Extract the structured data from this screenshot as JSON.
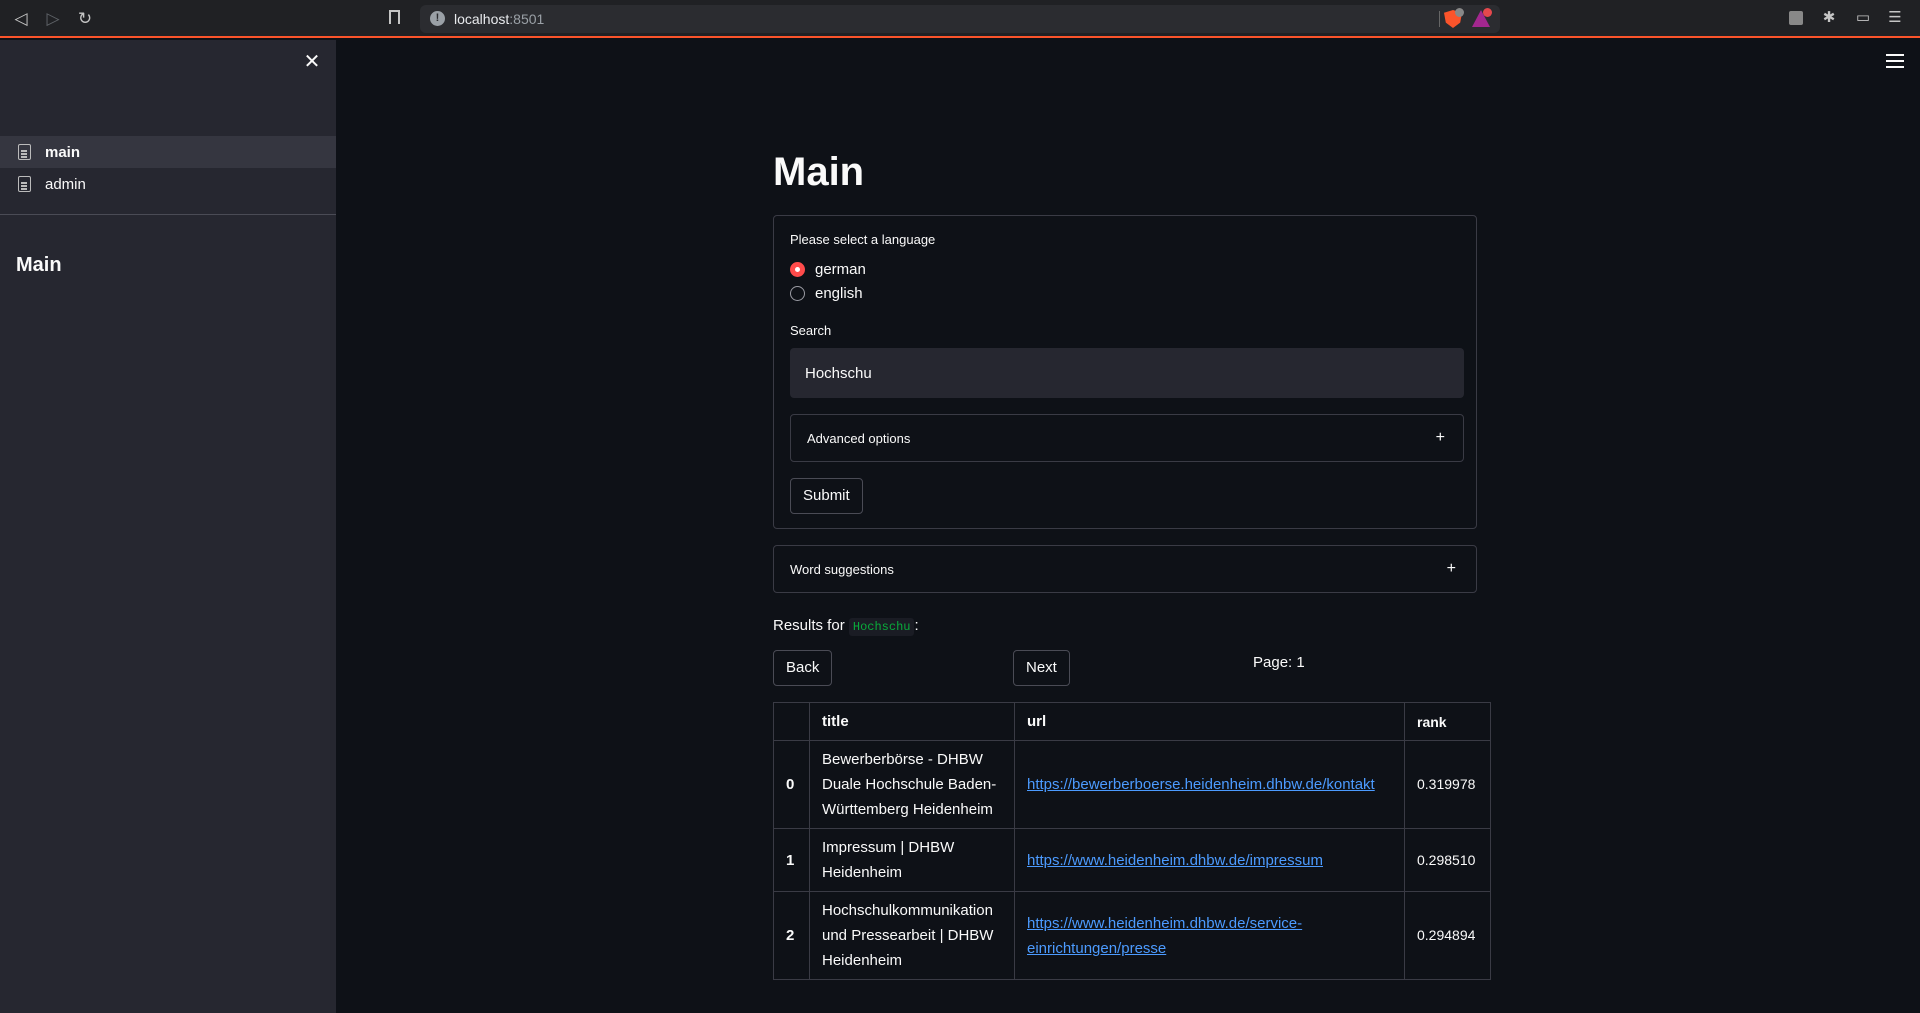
{
  "browser": {
    "url_host": "localhost",
    "url_port": ":8501"
  },
  "sidebar": {
    "items": [
      {
        "label": "main"
      },
      {
        "label": "admin"
      }
    ],
    "title": "Main"
  },
  "main": {
    "title": "Main",
    "language_label": "Please select a language",
    "languages": [
      "german",
      "english"
    ],
    "selected_language": "german",
    "search_label": "Search",
    "search_value": "Hochschu",
    "advanced_label": "Advanced options",
    "submit_label": "Submit",
    "suggestions_label": "Word suggestions",
    "results_prefix": "Results for",
    "results_query": "Hochschu",
    "results_suffix": ":",
    "back_label": "Back",
    "next_label": "Next",
    "page_label": "Page: 1"
  },
  "table": {
    "headers": [
      "",
      "title",
      "url",
      "rank"
    ],
    "rows": [
      {
        "idx": "0",
        "title": "Bewerberbörse - DHBW Duale Hochschule Baden-Württemberg Heidenheim",
        "url": "https://bewerberboerse.heidenheim.dhbw.de/kontakt",
        "rank": "0.319978"
      },
      {
        "idx": "1",
        "title": "Impressum | DHBW Heidenheim",
        "url": "https://www.heidenheim.dhbw.de/impressum",
        "rank": "0.298510"
      },
      {
        "idx": "2",
        "title": "Hochschulkommunikation und Pressearbeit | DHBW Heidenheim",
        "url": "https://www.heidenheim.dhbw.de/service-einrichtungen/presse",
        "rank": "0.294894"
      }
    ]
  },
  "colors": {
    "accent": "#ff4b4b",
    "background": "#0e1117",
    "sidebar": "#262730",
    "link": "#4c9bff",
    "code": "#09ab3b"
  }
}
